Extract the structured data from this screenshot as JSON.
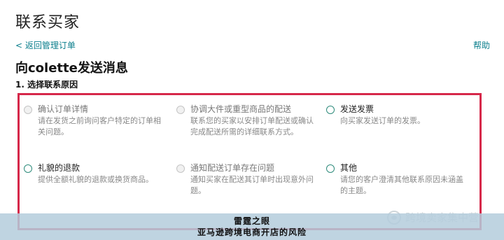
{
  "page": {
    "title": "联系买家",
    "back_link": "< 返回管理订单",
    "help_link": "帮助",
    "heading": "向colette发送消息",
    "step": "1. 选择联系原因"
  },
  "reasons": [
    {
      "label": "确认订单详情",
      "description": "请在发货之前询问客户特定的订单相关问题。",
      "enabled": false
    },
    {
      "label": "协调大件或重型商品的配送",
      "description": "联系您的买家以安排订单配送或确认完成配送所需的详细联系方式。",
      "enabled": false
    },
    {
      "label": "发送发票",
      "description": "向买家发送订单的发票。",
      "enabled": true
    },
    {
      "label": "礼貌的退款",
      "description": "提供全额礼貌的退款或换货商品。",
      "enabled": true
    },
    {
      "label": "通知配送订单存在问题",
      "description": "通知买家在配送其订单时出现意外问题。",
      "enabled": false
    },
    {
      "label": "其他",
      "description": "请您的客户澄清其他联系原因未涵盖的主题。",
      "enabled": true
    }
  ],
  "watermark": {
    "text": "跨境卖家集中营",
    "icon": "wechat-icon"
  },
  "banner": {
    "line1": "雷霆之眼",
    "line2": "亚马逊跨境电商开店的风险"
  },
  "colors": {
    "link": "#0a7e8c",
    "box_border": "#d6284a",
    "radio_enabled": "#2e8b7b",
    "banner_bg": "#b4cddc"
  }
}
